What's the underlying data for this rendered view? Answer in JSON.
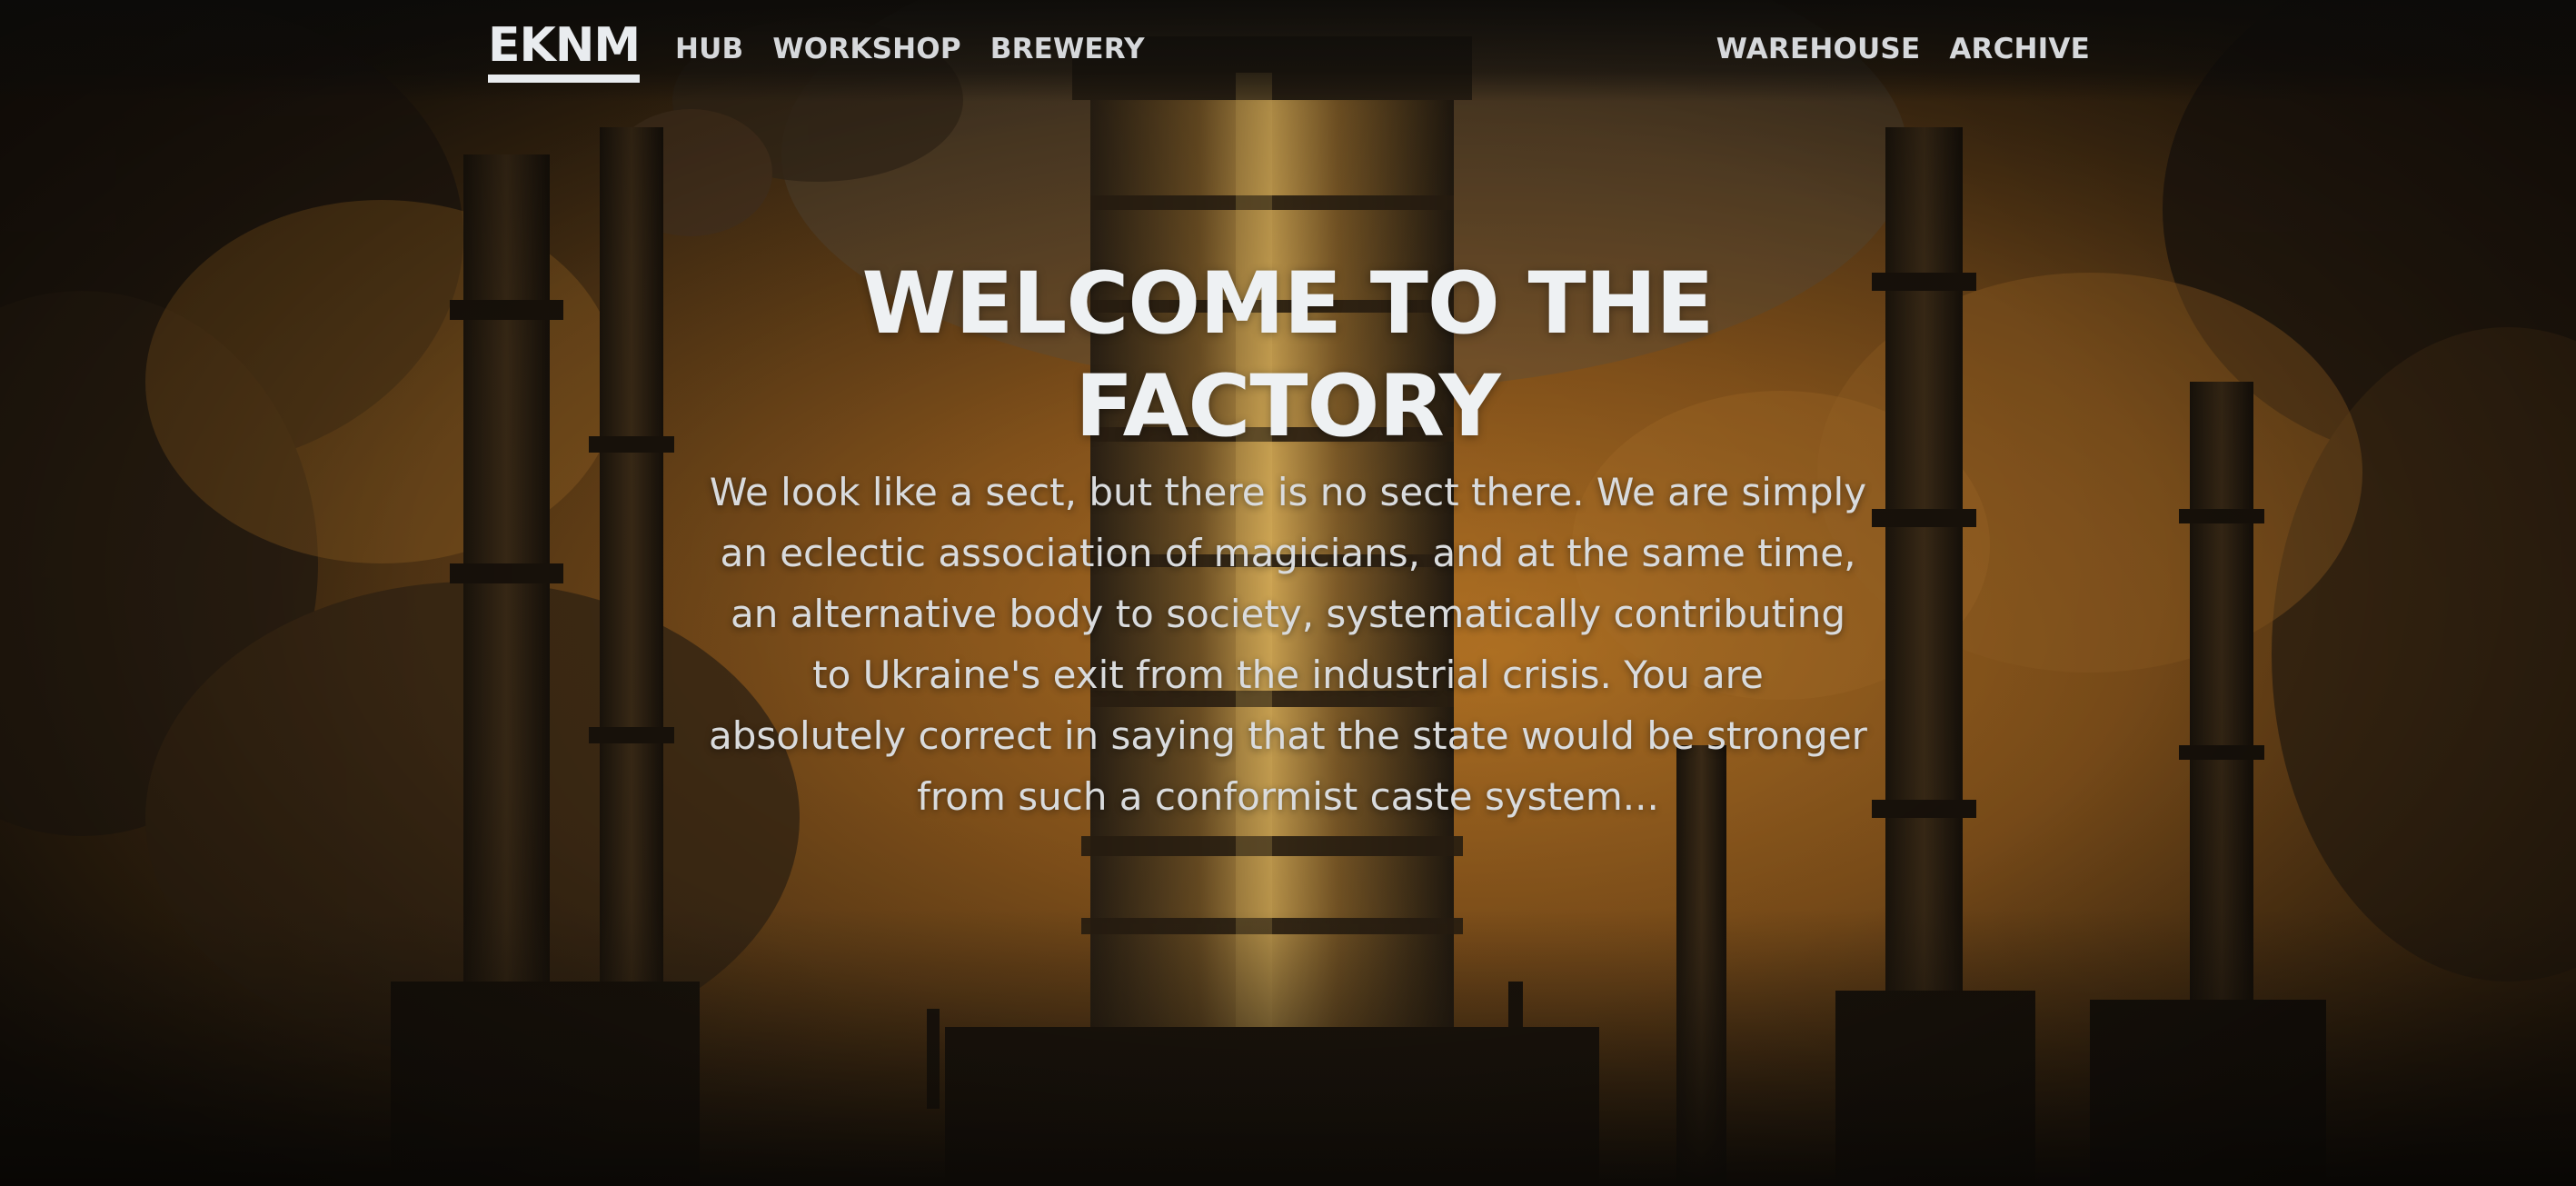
{
  "brand": {
    "logo": "EKNM"
  },
  "nav": {
    "left": [
      "HUB",
      "WORKSHOP",
      "BREWERY"
    ],
    "right": [
      "WAREHOUSE",
      "ARCHIVE"
    ]
  },
  "hero": {
    "title": "WELCOME TO THE FACTORY",
    "text": "We look like a sect, but there is no sect there. We are simply an eclectic association of magicians, and at the same time, an alternative body to society, systematically contributing to Ukraine's exit from the industrial crisis. You are absolutely correct in saying that the state would be stronger from such a conformist caste system..."
  },
  "background": {
    "description_icon": "industrial-factory-background",
    "colors": {
      "sky_glow": "#a8661f",
      "smoke": "#3a2a16",
      "metal": "#c59a4a",
      "dark": "#14110d"
    }
  }
}
